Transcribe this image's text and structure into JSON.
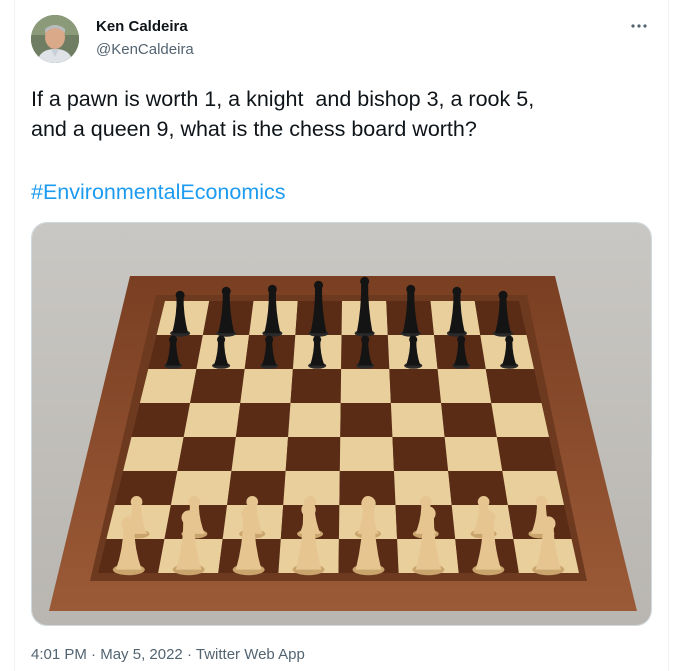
{
  "author": {
    "name": "Ken Caldeira",
    "handle": "@KenCaldeira"
  },
  "tweet": {
    "text": "If a pawn is worth 1, a knight  and bishop 3, a rook 5,\nand a queen 9, what is the chess board worth?",
    "hashtag": "#EnvironmentalEconomics",
    "time": "4:01 PM",
    "separator": "·",
    "date": "May 5, 2022",
    "source": "Twitter Web App"
  },
  "icons": {
    "more": "more-options-icon"
  },
  "colors": {
    "link": "#1d9bf0",
    "secondary_text": "#536471",
    "primary_text": "#0f1419"
  }
}
